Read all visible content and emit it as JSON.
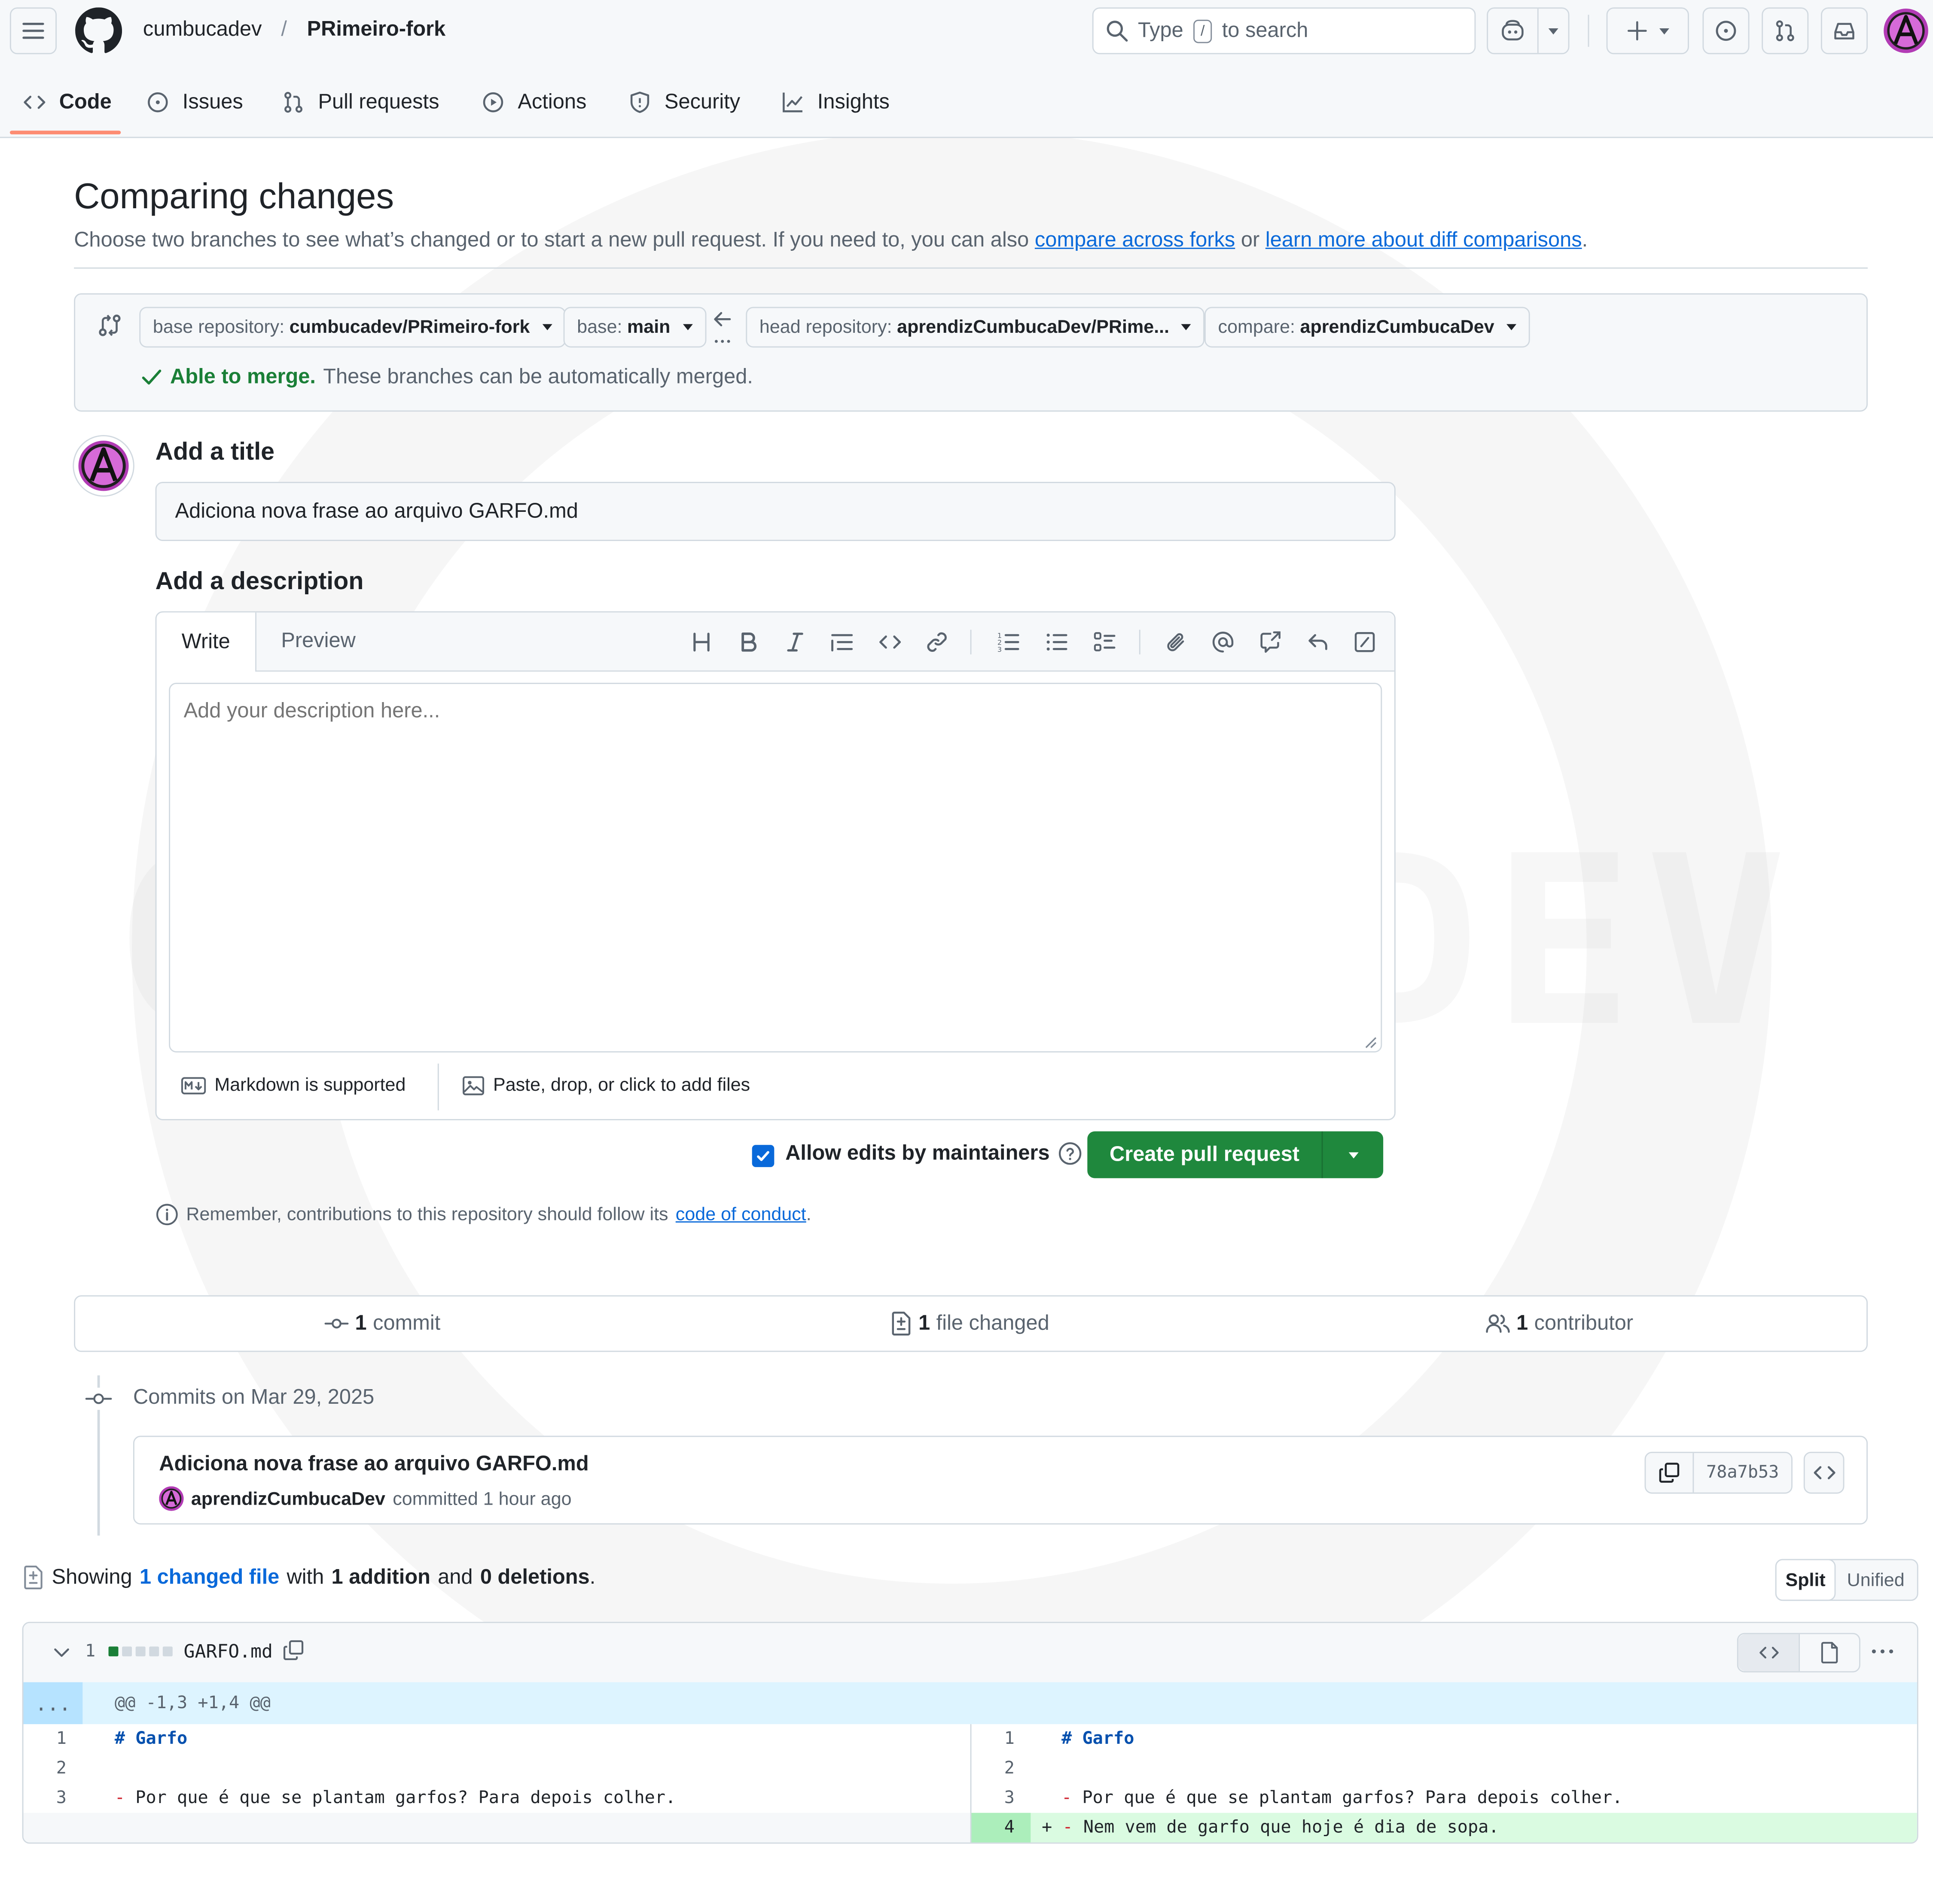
{
  "header": {
    "owner": "cumbucadev",
    "separator": "/",
    "repo": "PRimeiro-fork",
    "search_prefix": "Type",
    "search_key": "/",
    "search_suffix": "to search"
  },
  "tabs": [
    {
      "label": "Code",
      "icon": "code-icon",
      "active": true
    },
    {
      "label": "Issues",
      "icon": "issue-opened-icon"
    },
    {
      "label": "Pull requests",
      "icon": "git-pull-request-icon"
    },
    {
      "label": "Actions",
      "icon": "play-icon"
    },
    {
      "label": "Security",
      "icon": "shield-icon"
    },
    {
      "label": "Insights",
      "icon": "graph-icon"
    }
  ],
  "compare": {
    "title": "Comparing changes",
    "subtitle_prefix": "Choose two branches to see what’s changed or to start a new pull request. If you need to, you can also",
    "link_forks": "compare across forks",
    "subtitle_or": "or",
    "link_learn": "learn more about diff comparisons",
    "subtitle_end": ".",
    "base_repo_label": "base repository:",
    "base_repo_value": "cumbucadev/PRimeiro-fork",
    "base_label": "base:",
    "base_value": "main",
    "head_repo_label": "head repository:",
    "head_repo_value": "aprendizCumbucaDev/PRime...",
    "compare_label": "compare:",
    "compare_value": "aprendizCumbucaDev",
    "merge_status": "Able to merge.",
    "merge_text": "These branches can be automatically merged."
  },
  "form": {
    "title_label": "Add a title",
    "title_value": "Adiciona nova frase ao arquivo GARFO.md",
    "desc_label": "Add a description",
    "tab_write": "Write",
    "tab_preview": "Preview",
    "desc_placeholder": "Add your description here...",
    "markdown_note": "Markdown is supported",
    "files_note": "Paste, drop, or click to add files",
    "allow_edits": "Allow edits by maintainers",
    "create_button": "Create pull request",
    "conduct_prefix": "Remember, contributions to this repository should follow its",
    "conduct_link": "code of conduct",
    "conduct_end": "."
  },
  "stats": {
    "commits_num": "1",
    "commits_label": "commit",
    "files_num": "1",
    "files_label": "file changed",
    "contributors_num": "1",
    "contributors_label": "contributor"
  },
  "commits": {
    "date_label": "Commits on Mar 29, 2025",
    "commit_title": "Adiciona nova frase ao arquivo GARFO.md",
    "author": "aprendizCumbucaDev",
    "committed": "committed 1 hour ago",
    "sha": "78a7b53"
  },
  "diff_summary": {
    "showing": "Showing",
    "changed_link": "1 changed file",
    "with": "with",
    "additions": "1 addition",
    "and": "and",
    "deletions": "0 deletions",
    "end": ".",
    "split": "Split",
    "unified": "Unified"
  },
  "file": {
    "count": "1",
    "name": "GARFO.md",
    "hunk_expand": "...",
    "hunk": "@@ -1,3 +1,4 @@",
    "left": [
      {
        "n": "1",
        "text": "# Garfo"
      },
      {
        "n": "2",
        "text": ""
      },
      {
        "n": "3",
        "text": "- Por que é que se plantam garfos? Para depois colher."
      }
    ],
    "right": [
      {
        "n": "1",
        "text": "# Garfo"
      },
      {
        "n": "2",
        "text": ""
      },
      {
        "n": "3",
        "text": "- Por que é que se plantam garfos? Para depois colher."
      },
      {
        "n": "4",
        "text": "+ - Nem vem de garfo que hoje é dia de sopa."
      }
    ]
  },
  "watermark_text": "CUMBUCA DEV",
  "colors": {
    "accent": "#0969da",
    "success": "#1a7f37",
    "primary_button": "#1f883d",
    "tab_underline": "#fd8c73",
    "addition_bg": "#dafbe1",
    "addition_num_bg": "#aceebb",
    "hunk_bg": "#ddf4ff"
  }
}
